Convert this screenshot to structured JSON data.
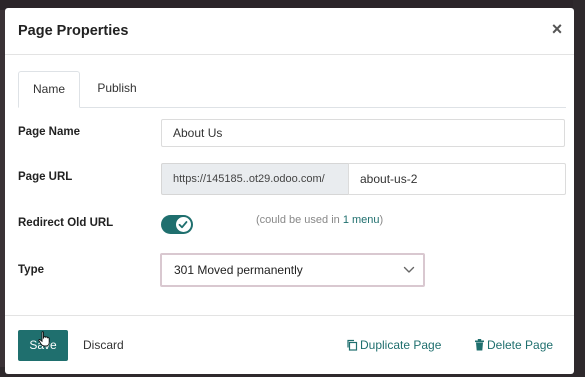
{
  "dialog": {
    "title": "Page Properties",
    "close_symbol": "×"
  },
  "tabs": [
    {
      "label": "Name",
      "active": true
    },
    {
      "label": "Publish",
      "active": false
    }
  ],
  "fields": {
    "page_name": {
      "label": "Page Name",
      "value": "About Us"
    },
    "page_url": {
      "label": "Page URL",
      "prefix": "https://145185..ot29.odoo.com/",
      "value": "about-us-2"
    },
    "redirect": {
      "label": "Redirect Old URL",
      "enabled": true,
      "hint_before": "(could be used in ",
      "hint_link": "1 menu",
      "hint_after": ")"
    },
    "type": {
      "label": "Type",
      "value": "301 Moved permanently"
    }
  },
  "footer": {
    "save_label": "Save",
    "discard_label": "Discard",
    "duplicate_label": "Duplicate Page",
    "delete_label": "Delete Page"
  },
  "colors": {
    "accent": "#1f6f6e",
    "backdrop": "#3a3236"
  },
  "icons": {
    "close": "close-icon",
    "toggle_check": "check-icon",
    "select_chevron": "chevron-down-icon",
    "duplicate": "copy-icon",
    "delete": "trash-icon",
    "cursor": "hand-cursor-icon"
  }
}
